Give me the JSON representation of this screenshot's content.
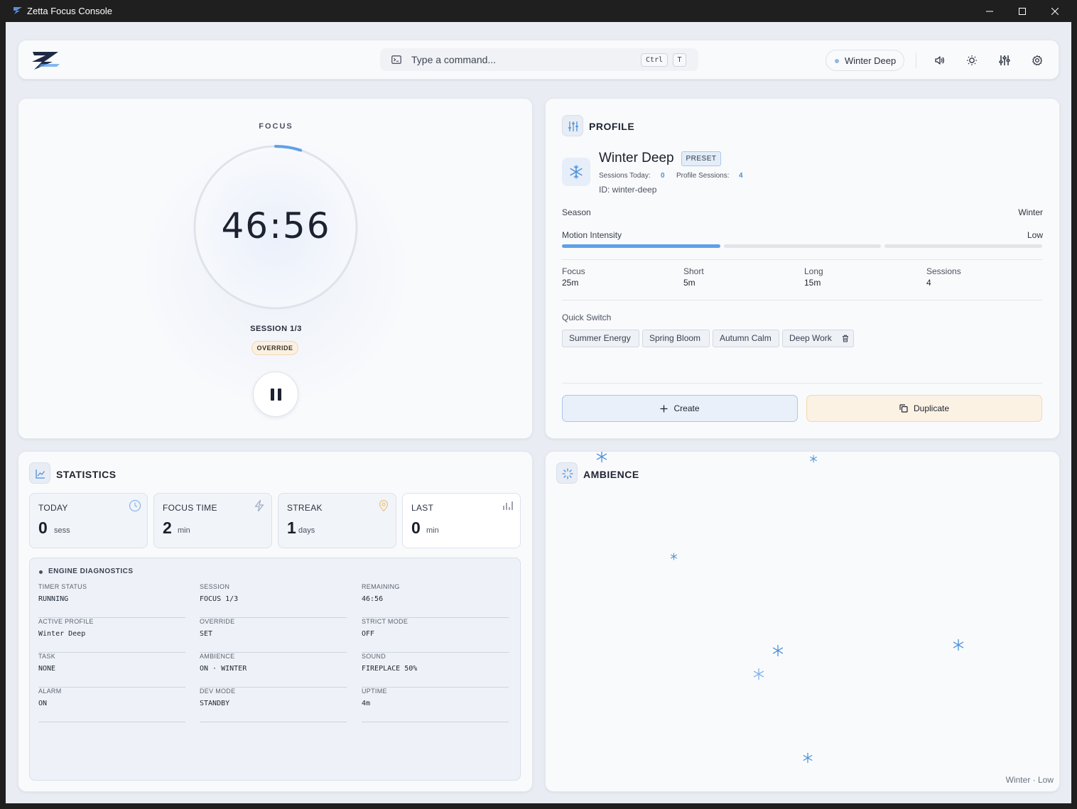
{
  "window": {
    "title": "Zetta Focus Console",
    "minimize": "—",
    "maximize": "☐",
    "close": "✕"
  },
  "topbar": {
    "command_placeholder": "Type a command...",
    "shortcut_keys": [
      "Ctrl",
      "T"
    ],
    "active_profile_pill": "Winter Deep",
    "icons": [
      "volume-icon",
      "sun-icon",
      "mixer-icon",
      "gear-icon"
    ]
  },
  "focus": {
    "mode_label": "FOCUS",
    "time": "46:56",
    "session_label": "SESSION 1/3",
    "override_badge": "OVERRIDE",
    "progress_fraction": 0.05
  },
  "profile": {
    "section_title": "PROFILE",
    "name": "Winter Deep",
    "badge": "PRESET",
    "sessions_today_label": "Sessions Today:",
    "sessions_today_value": "0",
    "profile_sessions_label": "Profile Sessions:",
    "profile_sessions_value": "4",
    "id_text": "ID: winter-deep",
    "season_label": "Season",
    "season_value": "Winter",
    "motion_label": "Motion Intensity",
    "motion_value": "Low",
    "motion_level": 1,
    "motion_levels_total": 3,
    "durations": [
      {
        "label": "Focus",
        "value": "25m"
      },
      {
        "label": "Short",
        "value": "5m"
      },
      {
        "label": "Long",
        "value": "15m"
      },
      {
        "label": "Sessions",
        "value": "4"
      }
    ],
    "quick_switch_label": "Quick Switch",
    "quick_switch": [
      "Summer Energy",
      "Spring Bloom",
      "Autumn Calm",
      "Deep Work"
    ],
    "create_label": "Create",
    "duplicate_label": "Duplicate"
  },
  "statistics": {
    "section_title": "STATISTICS",
    "tiles": [
      {
        "label": "TODAY",
        "value": "0",
        "unit": "sess",
        "icon": "clock-icon"
      },
      {
        "label": "FOCUS TIME",
        "value": "2",
        "unit": "min",
        "icon": "lightning-icon"
      },
      {
        "label": "STREAK",
        "value": "1",
        "unit": "days",
        "icon": "location-icon"
      },
      {
        "label": "LAST",
        "value": "0",
        "unit": "min",
        "icon": "bar-chart-icon"
      }
    ],
    "diagnostics_title": "ENGINE DIAGNOSTICS",
    "diagnostics": [
      {
        "label": "TIMER STATUS",
        "value": "RUNNING"
      },
      {
        "label": "SESSION",
        "value": "FOCUS 1/3"
      },
      {
        "label": "REMAINING",
        "value": "46:56"
      },
      {
        "label": "ACTIVE PROFILE",
        "value": "Winter Deep"
      },
      {
        "label": "OVERRIDE",
        "value": "SET"
      },
      {
        "label": "STRICT MODE",
        "value": "OFF"
      },
      {
        "label": "TASK",
        "value": "NONE"
      },
      {
        "label": "AMBIENCE",
        "value": "ON · WINTER"
      },
      {
        "label": "SOUND",
        "value": "FIREPLACE 50%"
      },
      {
        "label": "ALARM",
        "value": "ON"
      },
      {
        "label": "DEV MODE",
        "value": "STANDBY"
      },
      {
        "label": "UPTIME",
        "value": "4m"
      }
    ]
  },
  "ambience": {
    "section_title": "AMBIENCE",
    "footer": "Winter · Low"
  },
  "colors": {
    "accent": "#5fa0e8",
    "snowflake": "#4a90d9",
    "override_bg": "#fbf1e3",
    "preset_bg": "#e3edf9"
  }
}
